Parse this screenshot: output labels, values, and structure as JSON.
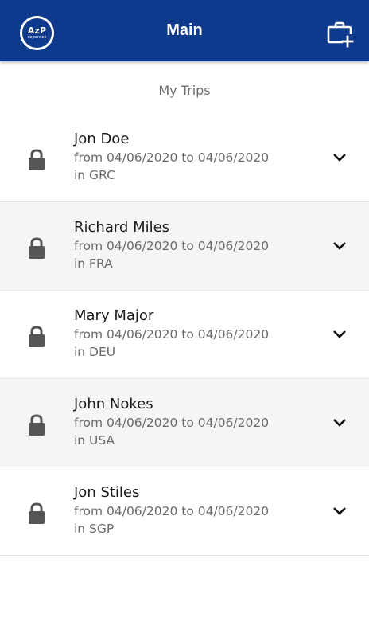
{
  "header": {
    "logo_text": "AzP",
    "logo_subtext": "expenses",
    "title": "Main"
  },
  "section_label": "My Trips",
  "icons": {
    "add_trip": "briefcase-plus-icon",
    "lock": "lock-icon",
    "expand": "chevron-down-icon"
  },
  "colors": {
    "header_bg": "#0d3a8c",
    "alt_row_bg": "#f5f5f5",
    "icon": "#555555"
  },
  "trips": [
    {
      "name": "Jon Doe",
      "dates": "from 04/06/2020 to 04/06/2020",
      "country": "in GRC"
    },
    {
      "name": "Richard Miles",
      "dates": "from 04/06/2020 to 04/06/2020",
      "country": "in FRA"
    },
    {
      "name": "Mary Major",
      "dates": "from 04/06/2020 to 04/06/2020",
      "country": "in DEU"
    },
    {
      "name": "John Nokes",
      "dates": "from 04/06/2020 to 04/06/2020",
      "country": "in USA"
    },
    {
      "name": "Jon Stiles",
      "dates": "from 04/06/2020 to 04/06/2020",
      "country": "in SGP"
    }
  ]
}
